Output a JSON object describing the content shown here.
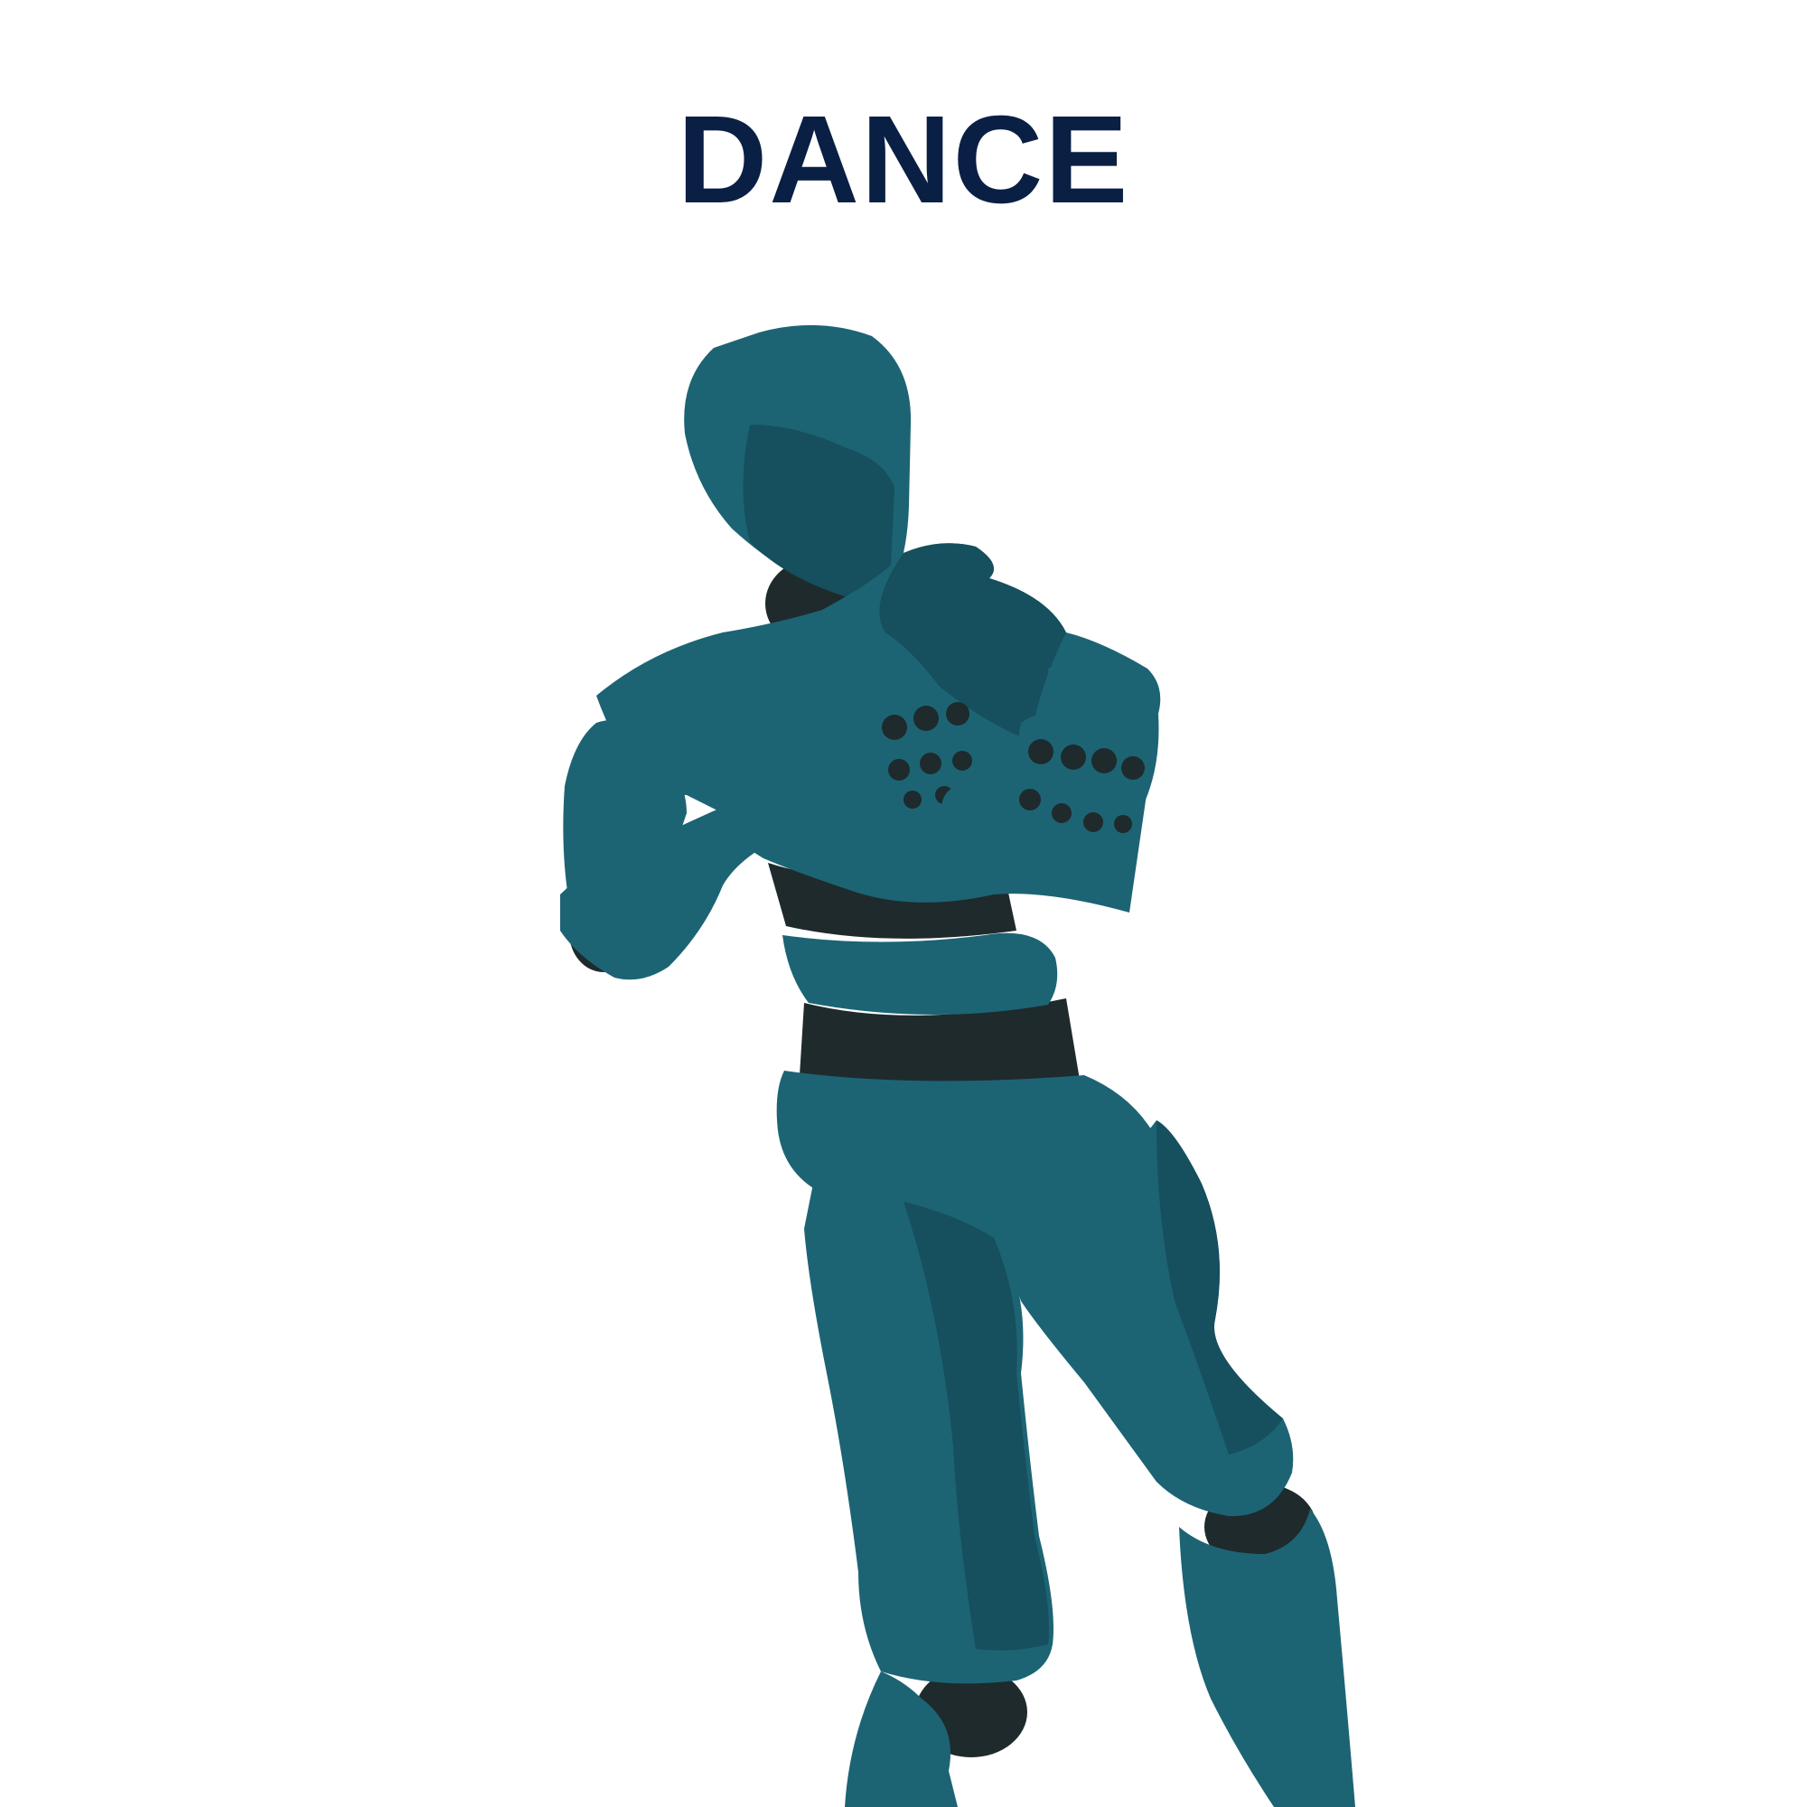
{
  "title": "DANCE",
  "colors": {
    "title_color": "#0a1f44",
    "body_color": "#1c6474",
    "body_shadow": "#164f5d",
    "body_highlight": "#24798a",
    "joint_color": "#1f2a2c",
    "background": "#ffffff"
  },
  "figure": {
    "subject": "mannequin-figure",
    "pose": "dance"
  }
}
